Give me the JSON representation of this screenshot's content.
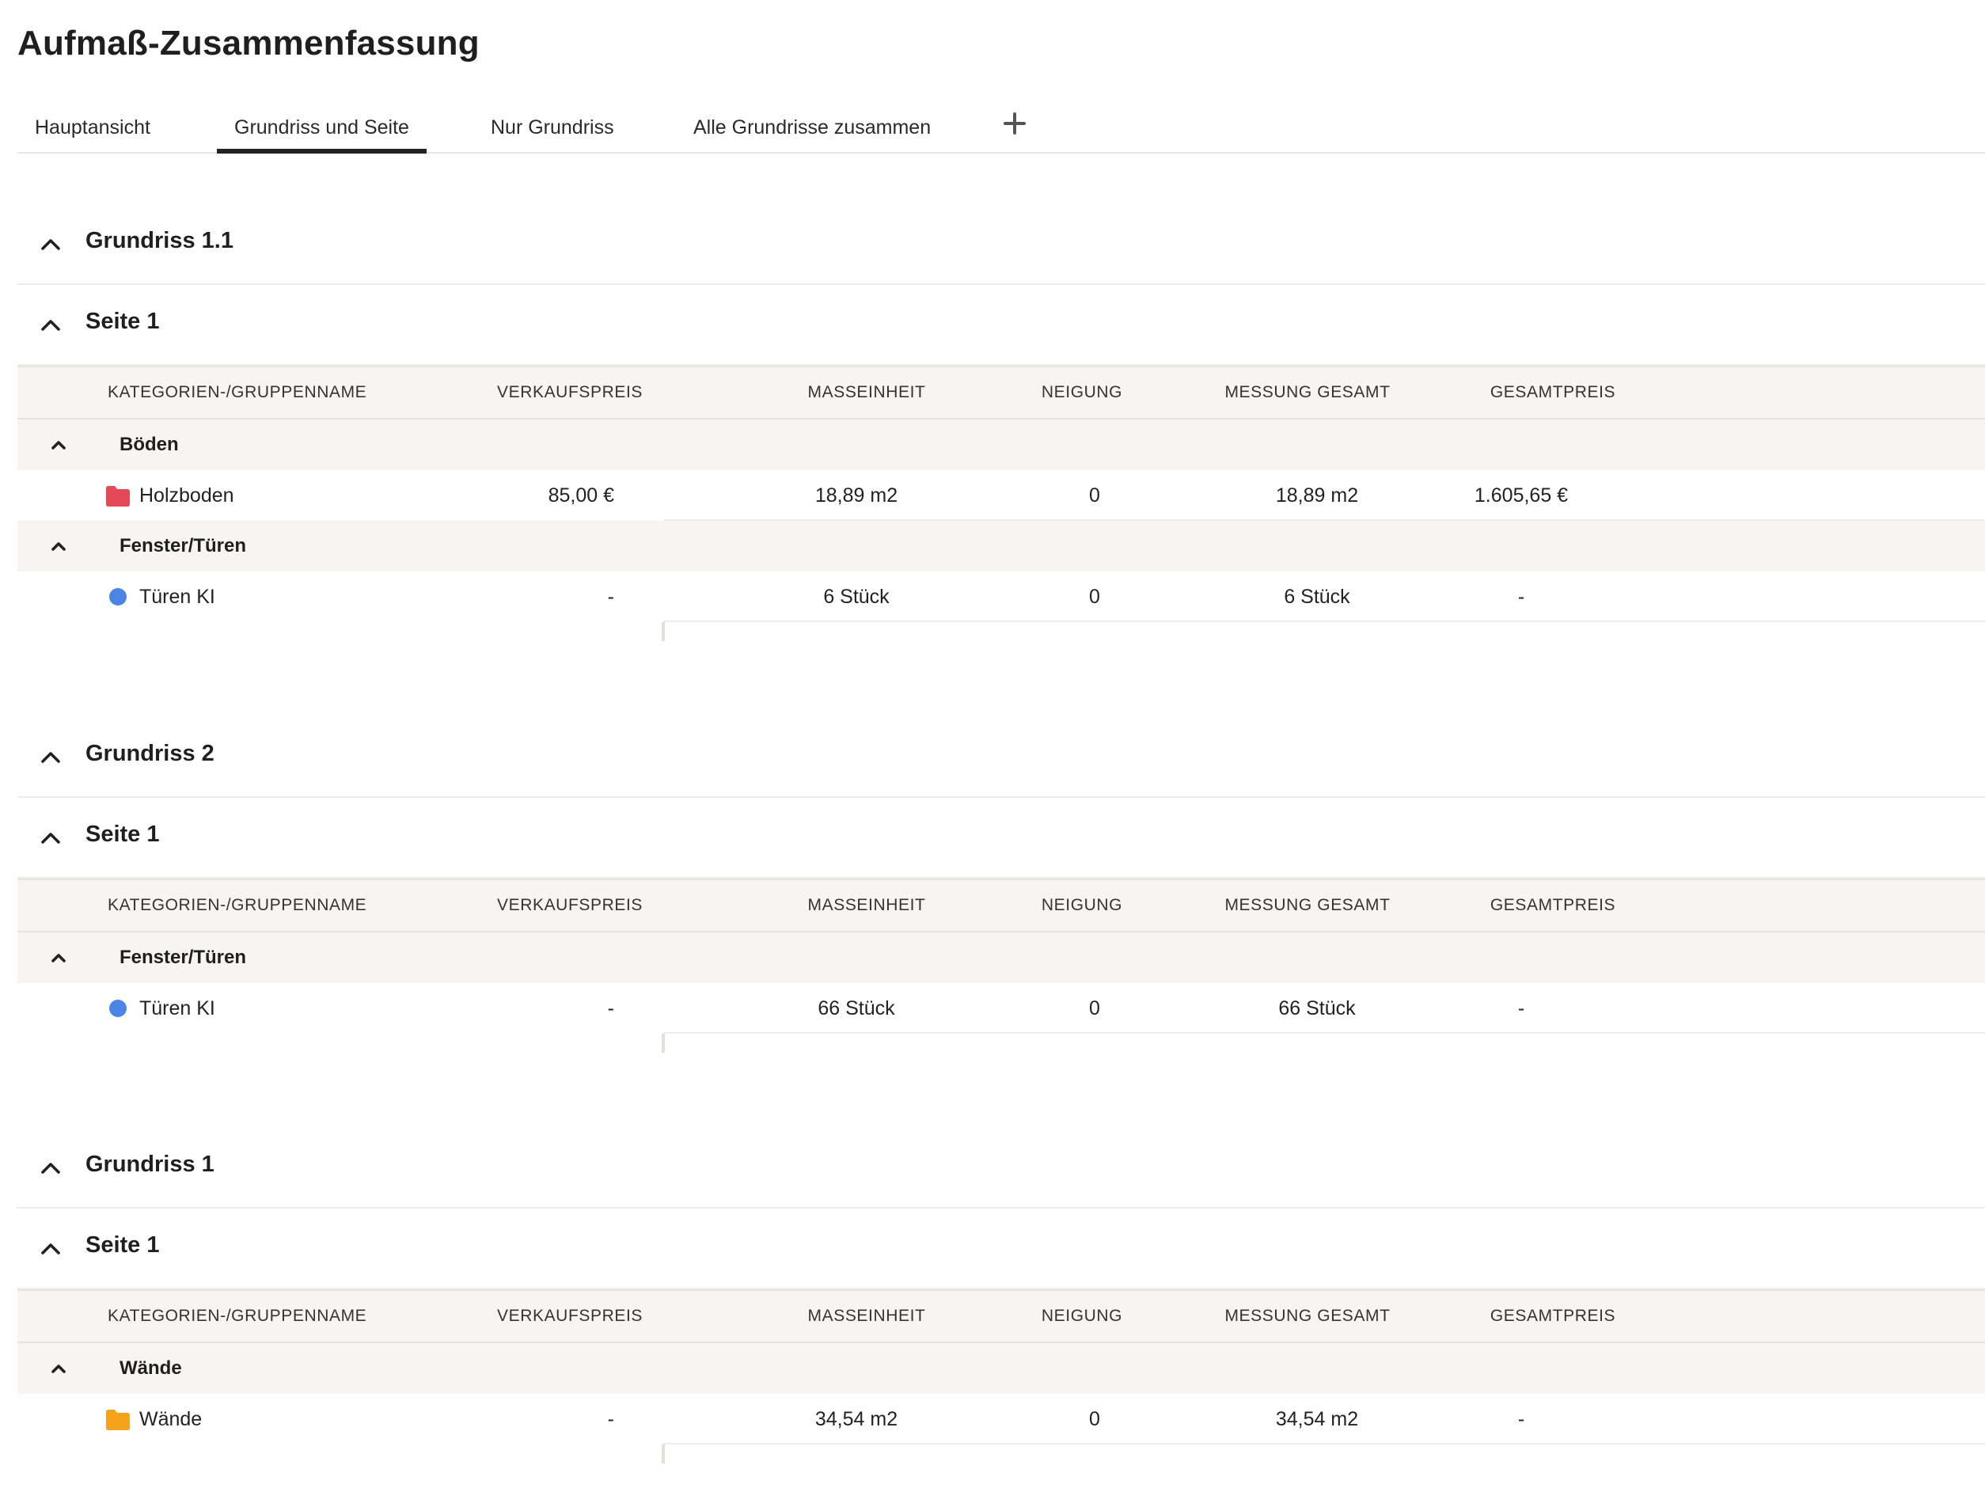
{
  "page": {
    "title": "Aufmaß-Zusammenfassung"
  },
  "tabs": [
    {
      "label": "Hauptansicht"
    },
    {
      "label": "Grundriss und Seite"
    },
    {
      "label": "Nur Grundriss"
    },
    {
      "label": "Alle Grundrisse zusammen"
    }
  ],
  "add_tab_icon": "plus-icon",
  "table_header": {
    "name": "KATEGORIEN-/GRUPPENNAME",
    "verkaufspreis": "VERKAUFSPREIS",
    "masseinheit": "MASSEINHEIT",
    "neigung": "NEIGUNG",
    "messung_gesamt": "MESSUNG GESAMT",
    "gesamtpreis": "GESAMTPREIS"
  },
  "colors": {
    "red_folder": "#e54856",
    "blue_dot": "#4a84e6",
    "orange_folder": "#f5a31a"
  },
  "sections": [
    {
      "grundriss": "Grundriss 1.1",
      "seite": "Seite 1",
      "groups": [
        {
          "name": "Böden",
          "items": [
            {
              "icon": "folder-icon",
              "color": "#e54856",
              "name": "Holzboden",
              "verkaufspreis": "85,00 €",
              "masseinheit": "18,89 m2",
              "neigung": "0",
              "messung_gesamt": "18,89 m2",
              "gesamtpreis": "1.605,65 €"
            }
          ]
        },
        {
          "name": "Fenster/Türen",
          "items": [
            {
              "icon": "dot-icon",
              "color": "#4a84e6",
              "name": "Türen KI",
              "verkaufspreis": "-",
              "masseinheit": "6 Stück",
              "neigung": "0",
              "messung_gesamt": "6 Stück",
              "gesamtpreis": "-"
            }
          ]
        }
      ]
    },
    {
      "grundriss": "Grundriss 2",
      "seite": "Seite 1",
      "groups": [
        {
          "name": "Fenster/Türen",
          "items": [
            {
              "icon": "dot-icon",
              "color": "#4a84e6",
              "name": "Türen KI",
              "verkaufspreis": "-",
              "masseinheit": "66 Stück",
              "neigung": "0",
              "messung_gesamt": "66 Stück",
              "gesamtpreis": "-"
            }
          ]
        }
      ]
    },
    {
      "grundriss": "Grundriss 1",
      "seite": "Seite 1",
      "groups": [
        {
          "name": "Wände",
          "items": [
            {
              "icon": "folder-icon",
              "color": "#f5a31a",
              "name": "Wände",
              "verkaufspreis": "-",
              "masseinheit": "34,54 m2",
              "neigung": "0",
              "messung_gesamt": "34,54 m2",
              "gesamtpreis": "-"
            }
          ]
        }
      ]
    }
  ]
}
